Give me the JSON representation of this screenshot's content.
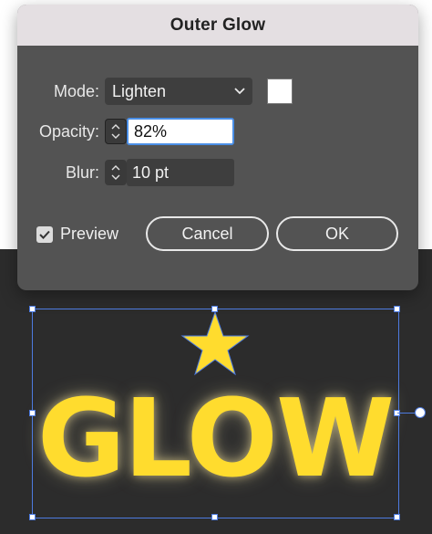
{
  "dialog": {
    "title": "Outer Glow",
    "mode": {
      "label": "Mode:",
      "value": "Lighten"
    },
    "swatch_color": "#ffffff",
    "opacity": {
      "label": "Opacity:",
      "value": "82%"
    },
    "blur": {
      "label": "Blur:",
      "value": "10 pt"
    },
    "preview": {
      "label": "Preview",
      "checked": true
    },
    "cancel_label": "Cancel",
    "ok_label": "OK"
  },
  "artwork": {
    "text": "GLOW",
    "fill_color": "#ffdc2e",
    "selection_color": "#4d7be0"
  },
  "icons": {
    "dropdown": "chevron-down-icon",
    "stepper": "stepper-arrows-icon",
    "checkbox": "checkmark-icon",
    "artwork_shape": "star-icon"
  }
}
